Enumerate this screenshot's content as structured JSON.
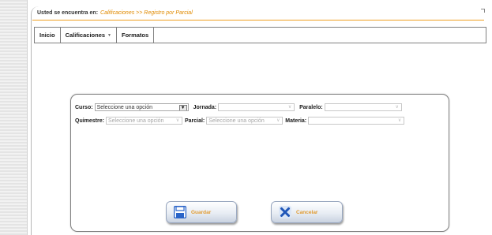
{
  "breadcrumb": {
    "label": "Usted se encuentra en:",
    "trail": "Calificaciones  >> Registro por Parcial"
  },
  "menu": {
    "items": [
      {
        "label": "Inicio"
      },
      {
        "label": "Calificaciones",
        "has_dropdown": true,
        "dropdown_glyph": "▼"
      },
      {
        "label": "Formatos"
      }
    ]
  },
  "form": {
    "curso": {
      "label": "Curso:",
      "value": "Seleccione una opción"
    },
    "jornada": {
      "label": "Jornada:",
      "value": ""
    },
    "paralelo": {
      "label": "Paralelo:",
      "value": ""
    },
    "quimestre": {
      "label": "Quimestre:",
      "value": "Seleccione una opción"
    },
    "parcial": {
      "label": "Parcial:",
      "value": "Seleccione una opción"
    },
    "materia": {
      "label": "Materia:",
      "value": ""
    }
  },
  "buttons": {
    "save": {
      "label": "Guardar",
      "icon": "floppy-disk-icon"
    },
    "cancel": {
      "label": "Cancelar",
      "icon": "cancel-x-icon"
    }
  },
  "colors": {
    "accent": "#f0a020",
    "trail": "#e08a00",
    "button_text": "#e09a30"
  }
}
